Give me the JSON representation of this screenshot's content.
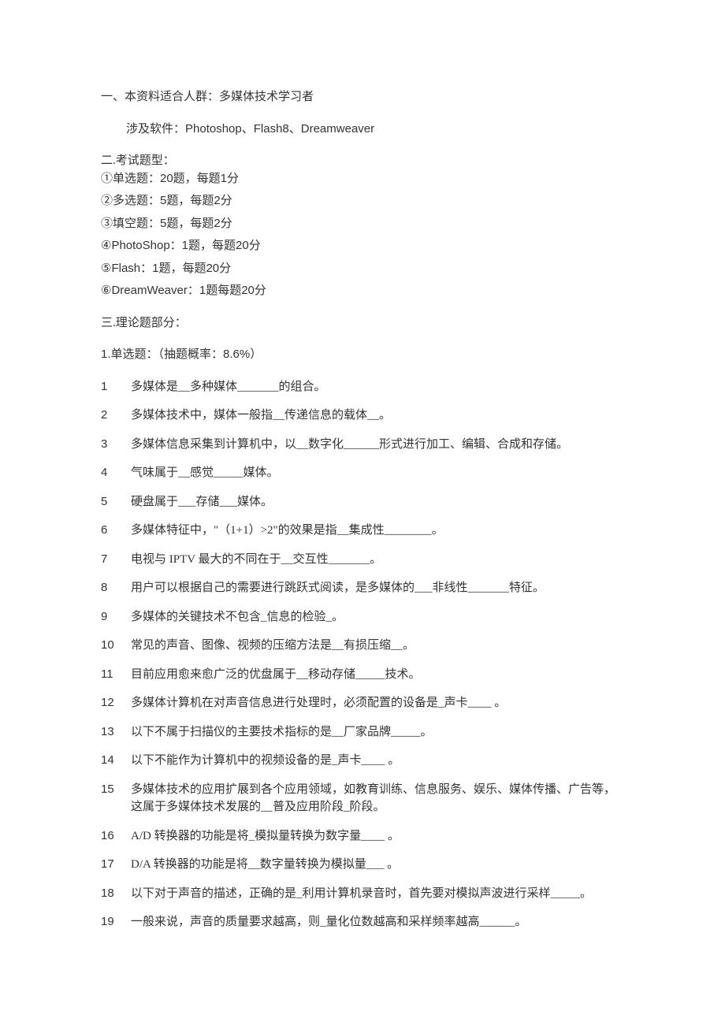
{
  "intro": {
    "line1_prefix": "一、本资料适合人群：",
    "line1_rest": "多媒体技术学习者",
    "line2_prefix": "涉及软件：",
    "line2_rest": "Photoshop、Flash8、Dreamweaver"
  },
  "exam": {
    "heading": "二.考试题型：",
    "items": [
      "①单选题：20题，每题1分",
      "②多选题：5题，每题2分",
      "③填空题：5题，每题2分",
      "④PhotoShop：1题，每题20分",
      "⑤Flash：1题，每题20分",
      "⑥DreamWeaver：1题每题20分"
    ]
  },
  "theory": {
    "heading": "三.理论题部分：",
    "subheading": "1.单选题：（抽题概率：8.6%）"
  },
  "questions": [
    {
      "n": "1",
      "t": "多媒体是__多种媒体_______的组合。"
    },
    {
      "n": "2",
      "t": "多媒体技术中，媒体一般指__传递信息的载体__。"
    },
    {
      "n": "3",
      "t": "多媒体信息采集到计算机中，以__数字化______形式进行加工、编辑、合成和存储。"
    },
    {
      "n": "4",
      "t": "气味属于__感觉_____媒体。"
    },
    {
      "n": "5",
      "t": "硬盘属于___存储___媒体。"
    },
    {
      "n": "6",
      "t": "多媒体特征中，\"（1+1）>2\"的效果是指__集成性________。"
    },
    {
      "n": "7",
      "t": "电视与 IPTV 最大的不同在于__交互性_______。"
    },
    {
      "n": "8",
      "t": "用户可以根据自己的需要进行跳跃式阅读，是多媒体的___非线性_______特征。"
    },
    {
      "n": "9",
      "t": "多媒体的关键技术不包含_信息的检验_。"
    },
    {
      "n": "10",
      "t": "常见的声音、图像、视频的压缩方法是__有损压缩__。"
    },
    {
      "n": "11",
      "t": "目前应用愈来愈广泛的优盘属于__移动存储_____技术。"
    },
    {
      "n": "12",
      "t": "多媒体计算机在对声音信息进行处理时，必须配置的设备是_声卡____ 。"
    },
    {
      "n": "13",
      "t": "以下不属于扫描仪的主要技术指标的是__厂家品牌_____。"
    },
    {
      "n": "14",
      "t": "以下不能作为计算机中的视频设备的是_声卡____ 。"
    },
    {
      "n": "15",
      "t": "多媒体技术的应用扩展到各个应用领域，如教育训练、信息服务、娱乐、媒体传播、广告等，这属于多媒体技术发展的__普及应用阶段_阶段。"
    },
    {
      "n": "16",
      "t": "A/D 转换器的功能是将_模拟量转换为数字量____ 。"
    },
    {
      "n": "17",
      "t": "D/A 转换器的功能是将__数字量转换为模拟量___ 。"
    },
    {
      "n": "18",
      "t": "以下对于声音的描述，正确的是_利用计算机录音时，首先要对模拟声波进行采样_____。"
    },
    {
      "n": "19",
      "t": "一般来说，声音的质量要求越高，则_量化位数越高和采样频率越高______。"
    }
  ]
}
